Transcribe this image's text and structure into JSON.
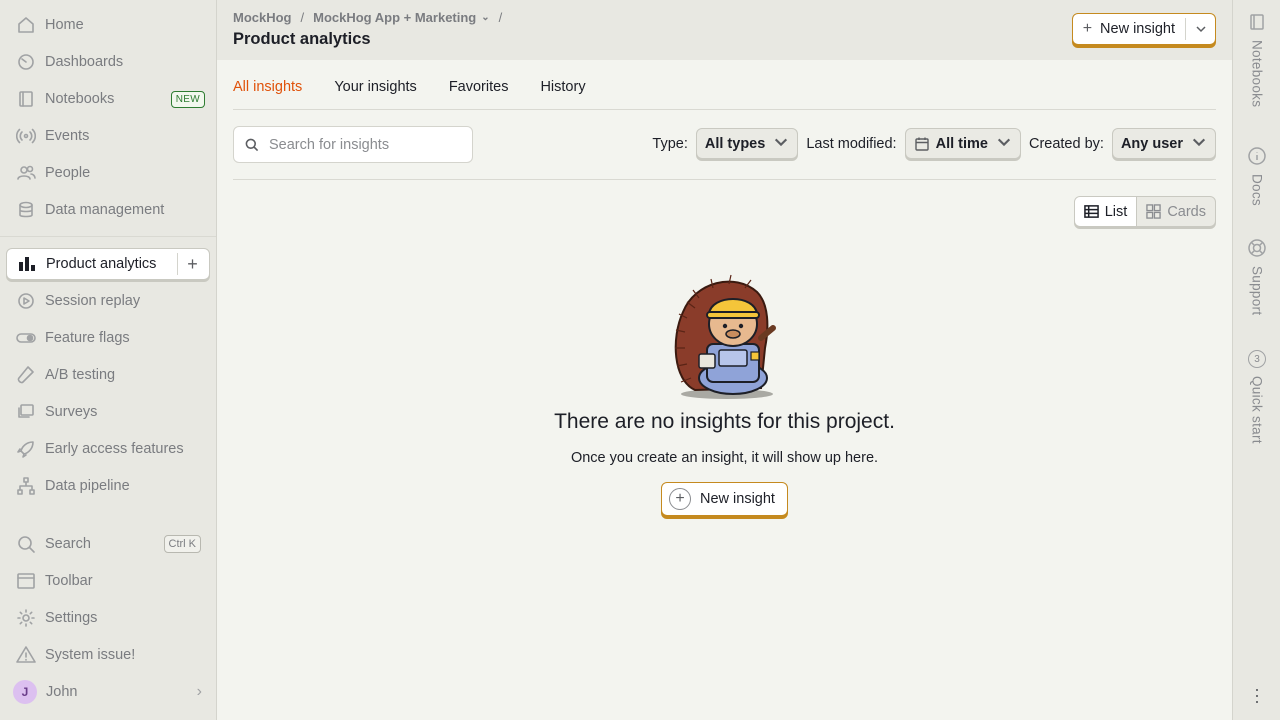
{
  "sidebar": {
    "items": [
      {
        "label": "Home",
        "icon": "home-icon"
      },
      {
        "label": "Dashboards",
        "icon": "dashboard-icon"
      },
      {
        "label": "Notebooks",
        "icon": "notebook-icon",
        "badge": "NEW"
      },
      {
        "label": "Events",
        "icon": "broadcast-icon"
      },
      {
        "label": "People",
        "icon": "people-icon"
      },
      {
        "label": "Data management",
        "icon": "database-icon"
      },
      {
        "label": "Product analytics",
        "icon": "bar-chart-icon",
        "active": true
      },
      {
        "label": "Session replay",
        "icon": "replay-icon"
      },
      {
        "label": "Feature flags",
        "icon": "toggle-icon"
      },
      {
        "label": "A/B testing",
        "icon": "flask-icon"
      },
      {
        "label": "Surveys",
        "icon": "survey-icon"
      },
      {
        "label": "Early access features",
        "icon": "rocket-icon"
      },
      {
        "label": "Data pipeline",
        "icon": "pipeline-icon"
      }
    ],
    "bottom": [
      {
        "label": "Search",
        "icon": "search-icon",
        "shortcut": "Ctrl K"
      },
      {
        "label": "Toolbar",
        "icon": "toolbar-icon"
      },
      {
        "label": "Settings",
        "icon": "gear-icon"
      },
      {
        "label": "System issue!",
        "icon": "warning-icon"
      }
    ],
    "user": {
      "initial": "J",
      "name": "John"
    }
  },
  "header": {
    "breadcrumb": [
      "MockHog",
      "MockHog App + Marketing"
    ],
    "title": "Product analytics",
    "new_insight_label": "New insight"
  },
  "tabs": [
    {
      "label": "All insights",
      "active": true
    },
    {
      "label": "Your insights"
    },
    {
      "label": "Favorites"
    },
    {
      "label": "History"
    }
  ],
  "filters": {
    "search_placeholder": "Search for insights",
    "type_label": "Type:",
    "type_value": "All types",
    "modified_label": "Last modified:",
    "modified_value": "All time",
    "created_label": "Created by:",
    "created_value": "Any user"
  },
  "view_toggle": {
    "list": "List",
    "cards": "Cards",
    "selected": "List"
  },
  "empty_state": {
    "title": "There are no insights for this project.",
    "subtitle": "Once you create an insight, it will show up here.",
    "button": "New insight"
  },
  "right_panel": [
    {
      "label": "Notebooks",
      "icon": "notebook-icon"
    },
    {
      "label": "Docs",
      "icon": "info-icon"
    },
    {
      "label": "Support",
      "icon": "lifebuoy-icon"
    },
    {
      "label": "Quick start",
      "count": "3"
    }
  ],
  "colors": {
    "accent": "#e0520a",
    "primary_border": "#c58a1f",
    "sidebar_bg": "#e8e8e2",
    "page_bg": "#f3f4ef"
  }
}
